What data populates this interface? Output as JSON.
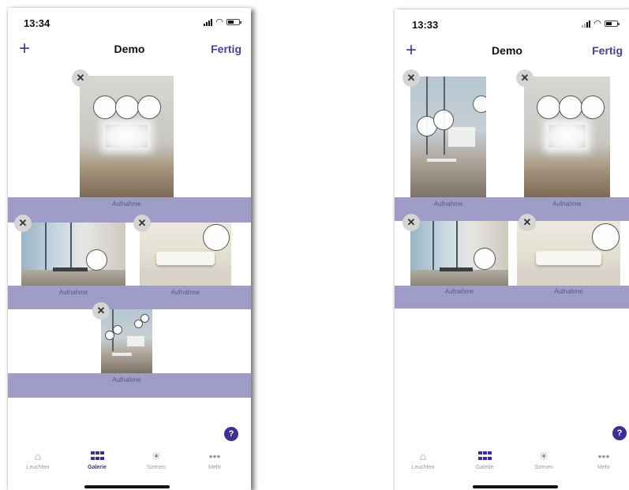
{
  "left": {
    "time": "13:34",
    "title": "Demo",
    "done_label": "Fertig",
    "add_label": "+",
    "images": [
      {
        "label": "Aufnahme",
        "scene": "gallery-room"
      },
      {
        "label": "Aufnahme",
        "scene": "office"
      },
      {
        "label": "Aufnahme",
        "scene": "living-room"
      },
      {
        "label": "Aufnahme",
        "scene": "hall"
      }
    ],
    "help_label": "?",
    "tabs": [
      {
        "label": "Leuchten",
        "icon": "ceiling-lamp-icon"
      },
      {
        "label": "Galerie",
        "icon": "grid-icon",
        "active": true
      },
      {
        "label": "Szenen",
        "icon": "sun-icon"
      },
      {
        "label": "Mehr",
        "icon": "more-icon"
      }
    ]
  },
  "right": {
    "time": "13:33",
    "title": "Demo",
    "done_label": "Fertig",
    "add_label": "+",
    "images": [
      {
        "label": "Aufnahme",
        "scene": "hall"
      },
      {
        "label": "Aufnahme",
        "scene": "gallery-room"
      },
      {
        "label": "Aufnahme",
        "scene": "office"
      },
      {
        "label": "Aufnahme",
        "scene": "living-room"
      }
    ],
    "help_label": "?",
    "tabs": [
      {
        "label": "Leuchten",
        "icon": "ceiling-lamp-icon"
      },
      {
        "label": "Galerie",
        "icon": "grid-icon",
        "active": true
      },
      {
        "label": "Szenen",
        "icon": "sun-icon"
      },
      {
        "label": "Mehr",
        "icon": "more-icon"
      }
    ]
  },
  "colors": {
    "accent": "#4a3f8c",
    "band": "#9f9cc8",
    "help_button": "#3f2f91"
  },
  "remove_glyph": "✕"
}
